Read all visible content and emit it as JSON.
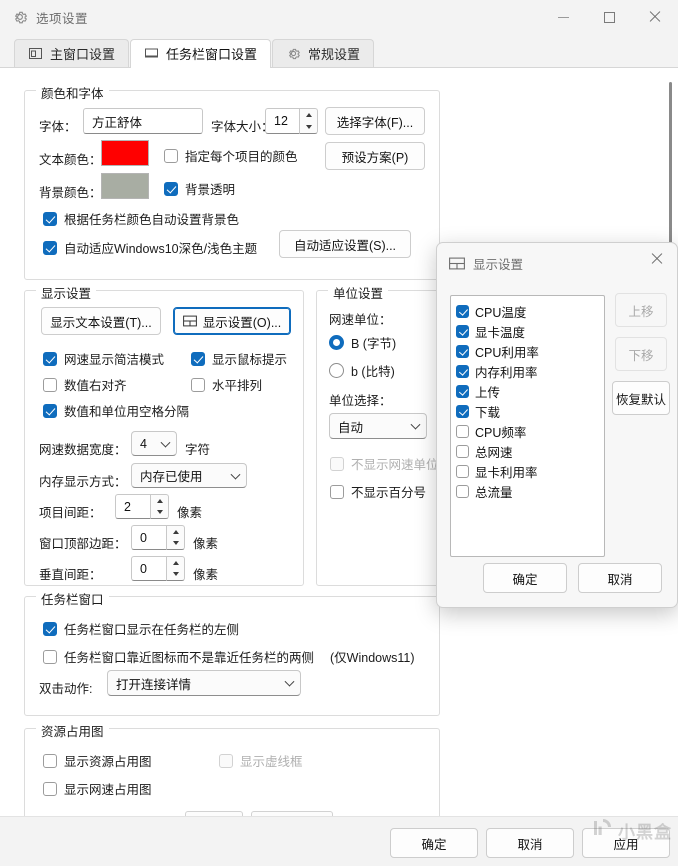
{
  "window": {
    "title": "选项设置",
    "icon": "gear-icon",
    "controls": {
      "minimize": "–",
      "maximize": "□",
      "close": "✕"
    }
  },
  "tabs": [
    {
      "label": "主窗口设置",
      "icon": "main-window-icon",
      "active": false
    },
    {
      "label": "任务栏窗口设置",
      "icon": "taskbar-window-icon",
      "active": true
    },
    {
      "label": "常规设置",
      "icon": "gear-icon",
      "active": false
    }
  ],
  "color_font_group": {
    "legend": "颜色和字体",
    "font_label": "字体：",
    "font_value": "方正舒体",
    "font_size_label": "字体大小：",
    "font_size_value": "12",
    "choose_font_button": "选择字体(F)...",
    "text_color_label": "文本颜色：",
    "text_color_value": "#FF0000",
    "per_item_color_checkbox": {
      "label": "指定每个项目的颜色",
      "checked": false
    },
    "preset_button": "预设方案(P)",
    "bg_color_label": "背景颜色：",
    "bg_color_value": "#A8ADA3",
    "bg_transparent_checkbox": {
      "label": "背景透明",
      "checked": true
    },
    "auto_bg_checkbox": {
      "label": "根据任务栏颜色自动设置背景色",
      "checked": true
    },
    "auto_theme_checkbox": {
      "label": "自动适应Windows10深色/浅色主题",
      "checked": true
    },
    "auto_theme_button": "自动适应设置(S)..."
  },
  "display_group": {
    "legend": "显示设置",
    "text_settings_button": "显示文本设置(T)...",
    "display_settings_button": "显示设置(O)...",
    "display_settings_icon": "grid-icon",
    "checkboxes": [
      {
        "label": "网速显示简洁模式",
        "checked": true
      },
      {
        "label": "显示鼠标提示",
        "checked": true
      },
      {
        "label": "数值右对齐",
        "checked": false
      },
      {
        "label": "水平排列",
        "checked": false
      },
      {
        "label": "数值和单位用空格分隔",
        "checked": true
      }
    ],
    "net_width_label": "网速数据宽度：",
    "net_width_value": "4",
    "net_width_unit": "字符",
    "mem_mode_label": "内存显示方式：",
    "mem_mode_value": "内存已使用",
    "item_spacing_label": "项目间距：",
    "item_spacing_value": "2",
    "item_spacing_unit": "像素",
    "top_margin_label": "窗口顶部边距：",
    "top_margin_value": "0",
    "top_margin_unit": "像素",
    "vertical_spacing_label": "垂直间距：",
    "vertical_spacing_value": "0",
    "vertical_spacing_unit": "像素"
  },
  "unit_group": {
    "legend": "单位设置",
    "net_unit_label": "网速单位：",
    "radio_bytes": {
      "label": "B (字节)",
      "selected": true
    },
    "radio_bits": {
      "label": "b (比特)",
      "selected": false
    },
    "unit_select_label": "单位选择：",
    "unit_select_value": "自动",
    "hide_net_unit_checkbox": {
      "label": "不显示网速单位",
      "checked": false,
      "disabled": true
    },
    "hide_percent_checkbox": {
      "label": "不显示百分号",
      "checked": false
    }
  },
  "taskbar_group": {
    "legend": "任务栏窗口",
    "left_side_checkbox": {
      "label": "任务栏窗口显示在任务栏的左侧",
      "checked": true
    },
    "near_icons_checkbox": {
      "label": "任务栏窗口靠近图标而不是靠近任务栏的两侧",
      "checked": false
    },
    "near_icons_note": "(仅Windows11)",
    "dblclick_label": "双击动作:",
    "dblclick_value": "打开连接详情"
  },
  "resource_group": {
    "legend": "资源占用图",
    "show_resource_checkbox": {
      "label": "显示资源占用图",
      "checked": false
    },
    "show_dashed_checkbox": {
      "label": "显示虚线框",
      "checked": false,
      "disabled": true
    },
    "show_netspeed_checkbox": {
      "label": "显示网速占用图",
      "checked": false
    }
  },
  "footer": {
    "ok_button": "确定",
    "cancel_button": "取消",
    "apply_button": "应用"
  },
  "dialog": {
    "title": "显示设置",
    "icon": "grid-icon",
    "close_icon": "close-icon",
    "items": [
      {
        "label": "CPU温度",
        "checked": true
      },
      {
        "label": "显卡温度",
        "checked": true
      },
      {
        "label": "CPU利用率",
        "checked": true
      },
      {
        "label": "内存利用率",
        "checked": true
      },
      {
        "label": "上传",
        "checked": true
      },
      {
        "label": "下载",
        "checked": true
      },
      {
        "label": "CPU频率",
        "checked": false
      },
      {
        "label": "总网速",
        "checked": false
      },
      {
        "label": "显卡利用率",
        "checked": false
      },
      {
        "label": "总流量",
        "checked": false
      }
    ],
    "move_up_button": {
      "label": "上移",
      "disabled": true
    },
    "move_down_button": {
      "label": "下移",
      "disabled": true
    },
    "restore_default_button": {
      "label": "恢复默认",
      "disabled": false
    },
    "ok_button": "确定",
    "cancel_button": "取消"
  },
  "watermark": {
    "text": "小黑盒"
  },
  "colors": {
    "accent": "#0f6cbd",
    "text_color_swatch": "#FF0000",
    "bg_color_swatch": "#A8ADA3",
    "window_bg": "#f3f3f3",
    "content_bg": "#ffffff"
  }
}
